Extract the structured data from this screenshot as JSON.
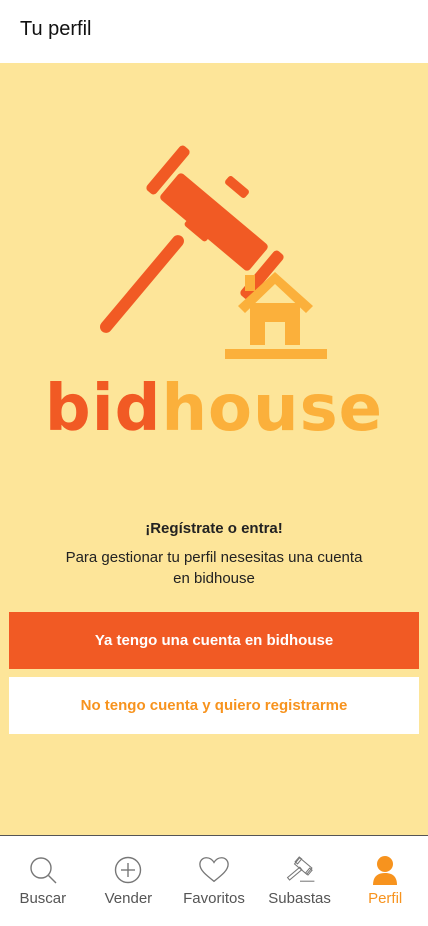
{
  "header": {
    "title": "Tu perfil"
  },
  "brand": {
    "bid": "bid",
    "house": "house",
    "primary_color": "#f15a24",
    "secondary_color": "#fbb03b"
  },
  "auth": {
    "title": "¡Regístrate o entra!",
    "message": "Para gestionar tu perfil nesesitas una cuenta en bidhouse",
    "login_label": "Ya tengo una cuenta en bidhouse",
    "register_label": "No tengo cuenta y quiero registrarme"
  },
  "tabbar": {
    "active": "Perfil",
    "items": [
      {
        "label": "Buscar",
        "icon": "search-icon"
      },
      {
        "label": "Vender",
        "icon": "plus-circle-icon"
      },
      {
        "label": "Favoritos",
        "icon": "heart-icon"
      },
      {
        "label": "Subastas",
        "icon": "gavel-icon"
      },
      {
        "label": "Perfil",
        "icon": "user-icon"
      }
    ]
  }
}
